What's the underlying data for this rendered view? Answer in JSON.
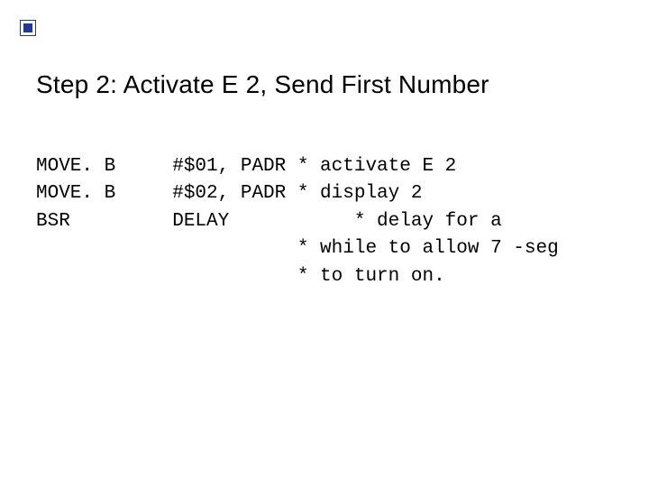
{
  "heading": "Step 2: Activate E 2, Send First Number",
  "code": "MOVE. B     #$01, PADR * activate E 2\nMOVE. B     #$02, PADR * display 2\nBSR         DELAY           * delay for a\n                       * while to allow 7 -seg\n                       * to turn on.",
  "accent_color": "#1f3a93"
}
